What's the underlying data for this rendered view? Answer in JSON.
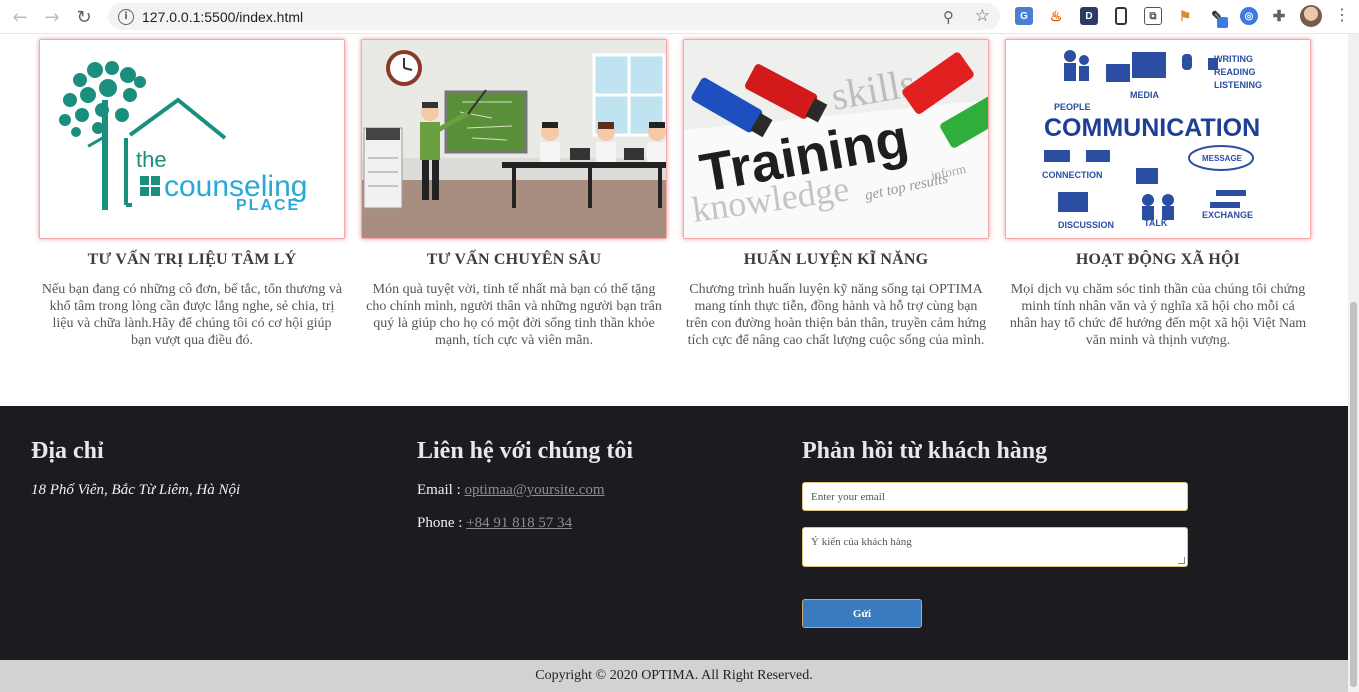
{
  "browser": {
    "url": "127.0.0.1:5500/index.html",
    "extensions": [
      "translate-icon",
      "flame-icon",
      "d-icon",
      "phone-icon",
      "screen-icon",
      "pin-icon",
      "eyedropper-icon",
      "compass-icon",
      "puzzle-icon",
      "avatar"
    ]
  },
  "cards": [
    {
      "title": "TƯ VẤN TRỊ LIỆU TÂM LÝ",
      "desc": "Nếu bạn đang có những cô đơn, bế tắc, tổn thương và khổ tâm trong lòng cần được lắng nghe, sẻ chia, trị liệu và chữa lành.Hãy để chúng tôi có cơ hội giúp bạn vượt qua điều đó.",
      "logo_top": "the",
      "logo_main": "counseling",
      "logo_bottom": "PLACE"
    },
    {
      "title": "TƯ VẤN CHUYÊN SÂU",
      "desc": "Món quà tuyệt vời, tinh tế nhất mà bạn có thể tặng cho chính mình, người thân và những người bạn trân quý là giúp cho họ có một đời sống tinh thần khỏe mạnh, tích cực và viên mãn."
    },
    {
      "title": "HUẤN LUYỆN KĨ NĂNG",
      "desc": "Chương trình huấn luyện kỹ năng sống tại OPTIMA mang tính thực tiễn, đồng hành và hỗ trợ cùng bạn trên con đường hoàn thiện bản thân, truyền cảm hứng tích cực để nâng cao chất lượng cuộc sống của mình.",
      "image_word": "Training",
      "image_words_small": [
        "skills",
        "knowledge",
        "get top results",
        "inform"
      ]
    },
    {
      "title": "HOẠT ĐỘNG XÃ HỘI",
      "desc": "Mọi dịch vụ chăm sóc tinh thần của chúng tôi chứng minh tính nhân văn và ý nghĩa xã hội cho mỗi cá nhân hay tổ chức để hướng đến một xã hội Việt Nam văn minh và thịnh vượng.",
      "image_word": "COMMUNICATION",
      "image_words_small": [
        "PEOPLE",
        "MEDIA",
        "WRITING",
        "READING",
        "LISTENING",
        "CONNECTION",
        "MESSAGE",
        "DISCUSSION",
        "TALK",
        "EXCHANGE"
      ]
    }
  ],
  "footer": {
    "address_heading": "Địa chỉ",
    "address": "18 Phố Viên, Bắc Từ Liêm, Hà Nội",
    "contact_heading": "Liên hệ với chúng tôi",
    "email_label": "Email :",
    "email": "optimaa@yoursite.com",
    "phone_label": "Phone :",
    "phone": "+84 91 818 57 34",
    "feedback_heading": "Phản hồi từ khách hàng",
    "email_placeholder": "Enter your email",
    "comment_placeholder": "Ý kiến của khách hàng",
    "send_label": "Gửi"
  },
  "copyright": "Copyright © 2020 OPTIMA. All Right Reserved.",
  "colors": {
    "footer_bg": "#1c1b20",
    "copyright_bg": "#d2d2d2",
    "button": "#3a7bbf",
    "teal_logo": "#1a8f7e"
  }
}
